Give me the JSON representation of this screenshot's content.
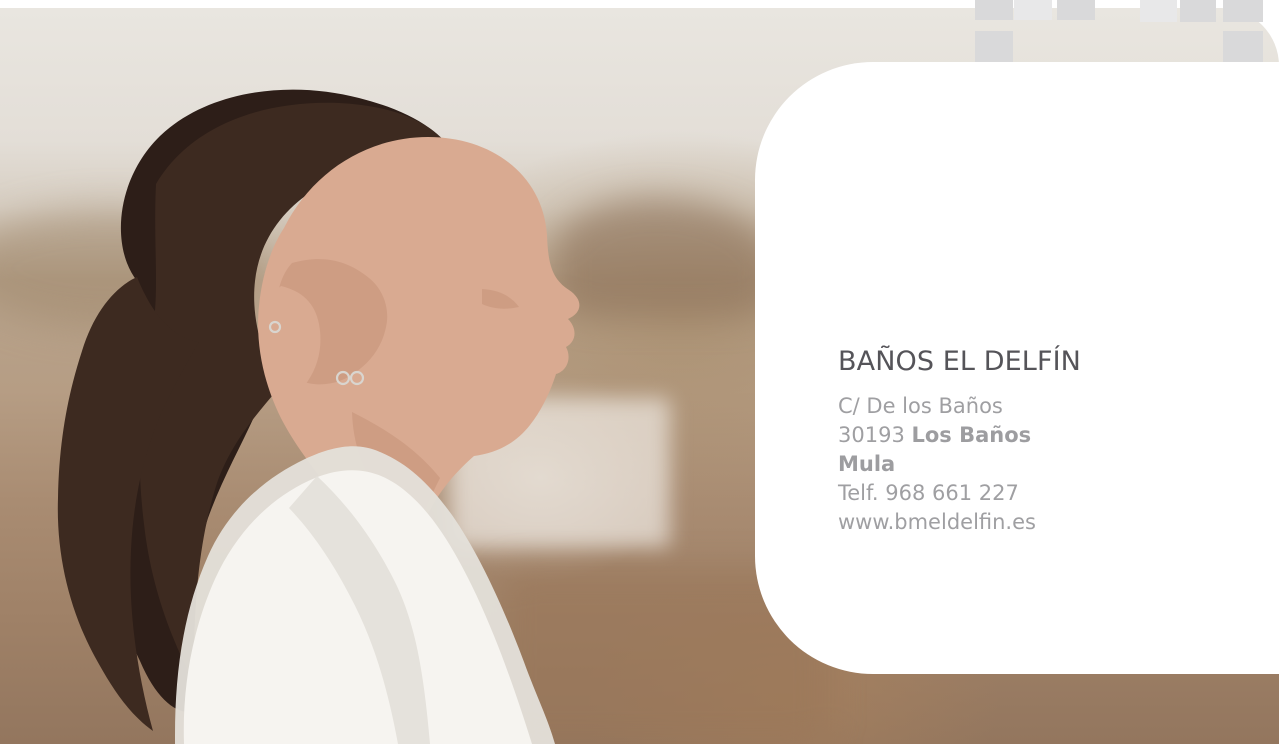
{
  "business": {
    "name": "BAÑOS EL DELFÍN",
    "street": "C/ De los Baños",
    "postal_code": "30193",
    "locality": "Los Baños",
    "town": "Mula",
    "phone": "Telf. 968 661 227",
    "website": "www.bmeldelfin.es"
  },
  "branding": {
    "accent_color": "#4fc4dc",
    "logo_icon": "smiling-face-icon"
  }
}
